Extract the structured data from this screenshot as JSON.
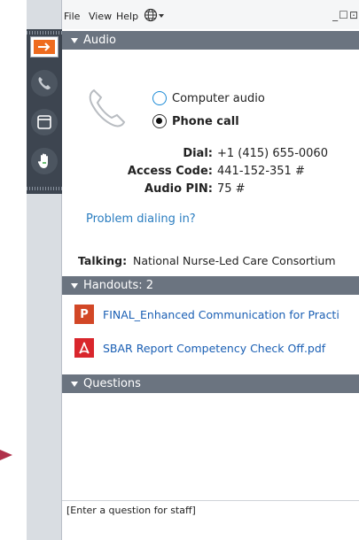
{
  "menu": {
    "file": "File",
    "view": "View",
    "help": "Help"
  },
  "audio": {
    "header": "Audio",
    "options": [
      "Computer audio",
      "Phone call"
    ],
    "selected": "Phone call",
    "dial_label": "Dial:",
    "dial_value": "+1 (415) 655-0060",
    "access_label": "Access Code:",
    "access_value": "441-152-351 #",
    "pin_label": "Audio PIN:",
    "pin_value": "75 #",
    "problem_link": "Problem dialing in?",
    "talking_label": "Talking:",
    "talking_value": "National Nurse-Led Care Consortium"
  },
  "handouts": {
    "header": "Handouts: 2",
    "items": [
      {
        "name": "FINAL_Enhanced Communication for Practi",
        "icon": "powerpoint-file-icon",
        "badge": "P",
        "color": "#d24726"
      },
      {
        "name": "SBAR Report Competency Check Off.pdf",
        "icon": "pdf-file-icon",
        "color": "#d9262c"
      }
    ]
  },
  "questions": {
    "header": "Questions",
    "input_value": "[Enter a question for staff]"
  },
  "colors": {
    "accent": "#ee6b1e",
    "header_bg": "#6b7480",
    "sidebar_bg": "#3d4550",
    "link": "#2a7dc0"
  }
}
